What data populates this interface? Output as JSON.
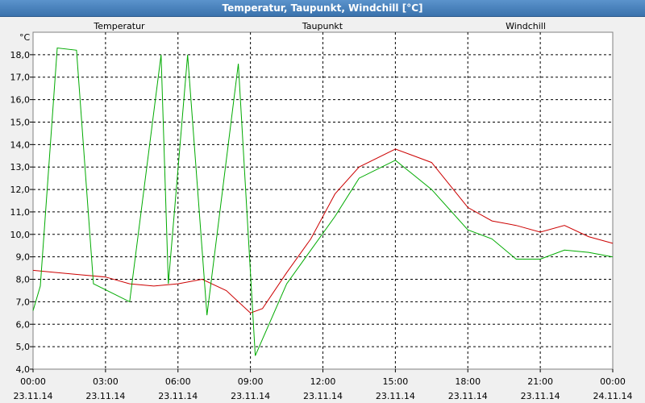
{
  "window": {
    "title": "Temperatur, Taupunkt, Windchill [°C]"
  },
  "chart_data": {
    "type": "line",
    "title": "Temperatur, Taupunkt, Windchill [°C]",
    "ylabel": "°C",
    "ylim": [
      4.0,
      19.0
    ],
    "xlim": [
      0,
      24
    ],
    "y_ticks": [
      4,
      5,
      6,
      7,
      8,
      9,
      10,
      11,
      12,
      13,
      14,
      15,
      16,
      17,
      18
    ],
    "y_tick_labels": [
      "4,0",
      "5,0",
      "6,0",
      "7,0",
      "8,0",
      "9,0",
      "10,0",
      "11,0",
      "12,0",
      "13,0",
      "14,0",
      "15,0",
      "16,0",
      "17,0",
      "18,0"
    ],
    "x_ticks": [
      0,
      3,
      6,
      9,
      12,
      15,
      18,
      21,
      24
    ],
    "x_tick_labels": [
      [
        "00:00",
        "23.11.14"
      ],
      [
        "03:00",
        "23.11.14"
      ],
      [
        "06:00",
        "23.11.14"
      ],
      [
        "09:00",
        "23.11.14"
      ],
      [
        "12:00",
        "23.11.14"
      ],
      [
        "15:00",
        "23.11.14"
      ],
      [
        "18:00",
        "23.11.14"
      ],
      [
        "21:00",
        "23.11.14"
      ],
      [
        "00:00",
        "24.11.14"
      ]
    ],
    "grid": true,
    "legend": [
      {
        "name": "Temperatur",
        "color": "#cc0000"
      },
      {
        "name": "Taupunkt",
        "color": "#000099"
      },
      {
        "name": "Windchill",
        "color": "#00aa00"
      }
    ],
    "series": [
      {
        "name": "Temperatur",
        "color": "#cc0000",
        "x": [
          0,
          1,
          2,
          3,
          4,
          5,
          6,
          7,
          8,
          9,
          9.5,
          10.5,
          11.5,
          12.5,
          13.5,
          15,
          16.5,
          18,
          19,
          20,
          21,
          22,
          23,
          24
        ],
        "y": [
          8.4,
          8.3,
          8.2,
          8.1,
          7.8,
          7.7,
          7.8,
          8.0,
          7.5,
          6.5,
          6.7,
          8.3,
          9.8,
          11.8,
          13.0,
          13.8,
          13.2,
          11.2,
          10.6,
          10.4,
          10.1,
          10.4,
          9.9,
          9.6
        ]
      },
      {
        "name": "Windchill",
        "color": "#00aa00",
        "x": [
          0,
          0.3,
          1,
          1.8,
          2.5,
          4,
          5.3,
          5.6,
          6.4,
          7.2,
          8.5,
          9.2,
          10.5,
          12.5,
          13.5,
          15,
          16.5,
          18,
          19,
          20,
          21,
          22,
          23,
          24
        ],
        "y": [
          6.6,
          7.7,
          18.3,
          18.2,
          7.8,
          7.0,
          18.0,
          7.8,
          18.0,
          6.4,
          17.6,
          4.6,
          7.8,
          10.8,
          12.5,
          13.3,
          12.0,
          10.2,
          9.8,
          8.9,
          8.9,
          9.3,
          9.2,
          9.0
        ]
      }
    ]
  }
}
